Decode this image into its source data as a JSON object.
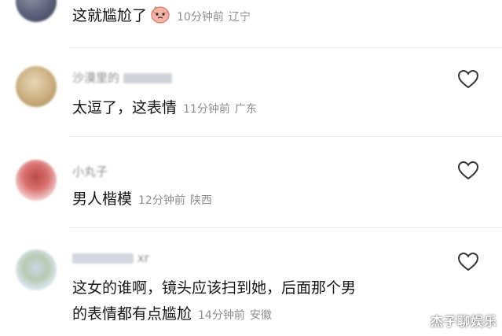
{
  "comments": [
    {
      "username": "",
      "text": "这就尴尬了",
      "emoji": "embarrassed-face-emoji",
      "time": "10分钟前",
      "location": "辽宁"
    },
    {
      "username": "沙漠里的",
      "text": "太逗了，这表情",
      "time": "11分钟前",
      "location": "广东"
    },
    {
      "username": "小丸子",
      "text": "男人楷模",
      "time": "12分钟前",
      "location": "陕西"
    },
    {
      "username": "xr",
      "text_line1": "这女的谁啊，镜头应该扫到她，后面那个男",
      "text_line2": "的表情都有点尴尬",
      "time": "14分钟前",
      "location": "安徽"
    }
  ],
  "like_icon": "heart-outline-icon",
  "watermark": "杰子聊娱乐",
  "colors": {
    "text": "#141414",
    "meta": "#8c8c8c",
    "divider": "#ececec",
    "icon": "#333333"
  }
}
